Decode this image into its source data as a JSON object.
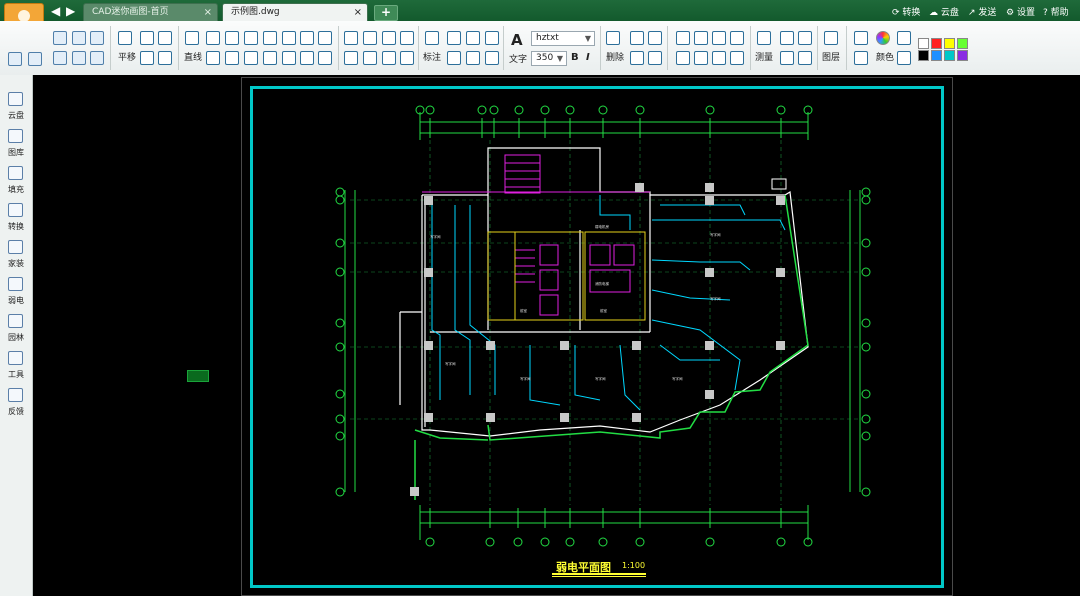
{
  "tabs": [
    {
      "label": "CAD迷你画图-首页",
      "close": "×"
    },
    {
      "label": "示例图.dwg",
      "close": "×"
    }
  ],
  "new_tab": "+",
  "header_menu": [
    "转换",
    "云盘",
    "发送",
    "设置",
    "帮助"
  ],
  "toolbar": {
    "pan_label": "平移",
    "line_label": "直线",
    "dim_label": "标注",
    "text_label": "文字",
    "font_name": "hztxt",
    "font_size": "350",
    "bold_label": "B",
    "italic_label": "I",
    "delete_label": "删除",
    "measure_label": "测量",
    "layer_label": "图层",
    "color_label": "颜色",
    "palette": [
      "#ffffff",
      "#ff2020",
      "#ffff00",
      "#66ff33",
      "#000000",
      "#1e90ff",
      "#00c8c8",
      "#8a2be2"
    ]
  },
  "sidebar": [
    {
      "label": "云盘",
      "icon": "cloud-icon"
    },
    {
      "label": "图库",
      "icon": "gallery-icon"
    },
    {
      "label": "填充",
      "icon": "hatch-icon"
    },
    {
      "label": "转换",
      "icon": "convert-icon"
    },
    {
      "label": "家装",
      "icon": "home-decor-icon"
    },
    {
      "label": "弱电",
      "icon": "low-voltage-icon"
    },
    {
      "label": "园林",
      "icon": "garden-icon"
    },
    {
      "label": "工具",
      "icon": "tools-icon"
    },
    {
      "label": "反馈",
      "icon": "feedback-icon"
    }
  ],
  "drawing": {
    "title": "弱电平面图",
    "scale": "1:100"
  }
}
